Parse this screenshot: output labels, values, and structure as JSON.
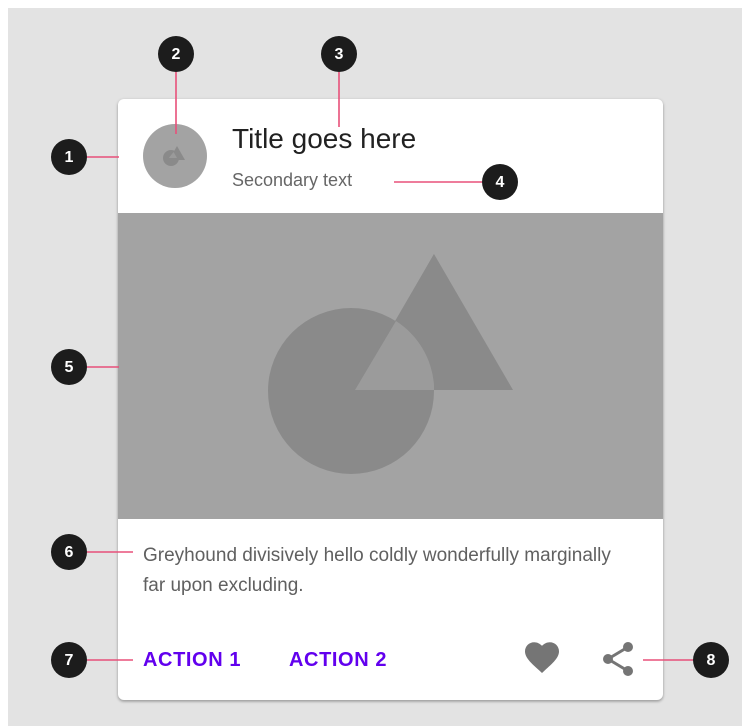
{
  "colors": {
    "background": "#e3e3e3",
    "card": "#ffffff",
    "placeholder": "#a3a3a3",
    "placeholder_shape": "#8a8a8a",
    "accent": "#6200ee",
    "annotation_line": "#e8507a",
    "marker": "#1c1c1c"
  },
  "card": {
    "title": "Title goes here",
    "secondary_text": "Secondary text",
    "supporting_text": "Greyhound divisively hello coldly wonderfully marginally far upon excluding.",
    "actions": [
      {
        "label": "ACTION 1"
      },
      {
        "label": "ACTION 2"
      }
    ],
    "icons": {
      "avatar": "avatar-placeholder-icon",
      "media": "media-placeholder-icon",
      "favorite": "heart-icon",
      "share": "share-icon"
    }
  },
  "markers": [
    "1",
    "2",
    "3",
    "4",
    "5",
    "6",
    "7",
    "8"
  ]
}
